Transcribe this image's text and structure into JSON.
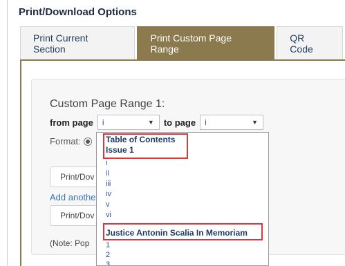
{
  "panel": {
    "title": "Print/Download Options"
  },
  "tabs": [
    {
      "label": "Print Current Section",
      "active": false
    },
    {
      "label": "Print Custom Page Range",
      "active": true
    },
    {
      "label": "QR Code",
      "active": false
    }
  ],
  "range": {
    "title": "Custom Page Range 1:",
    "from_label": "from page",
    "from_value": "i",
    "to_label": "to page",
    "to_value": "i"
  },
  "format": {
    "label": "Format:"
  },
  "buttons": {
    "print_download_1": "Print/Dov",
    "print_download_2": "Print/Dov"
  },
  "links": {
    "add_another": "Add anothe"
  },
  "note": "(Note: Pop",
  "dropdown": {
    "group_1_line1": "Table of Contents",
    "group_1_line2": "Issue 1",
    "items": [
      "i",
      "ii",
      "iii",
      "iv",
      "v",
      "vi"
    ],
    "group_2": "Justice Antonin Scalia In Memoriam",
    "items_after": [
      "1",
      "2",
      "3"
    ]
  },
  "colors": {
    "accent": "#8b7a4d",
    "highlight": "#e0343a",
    "link": "#3a72b6"
  }
}
